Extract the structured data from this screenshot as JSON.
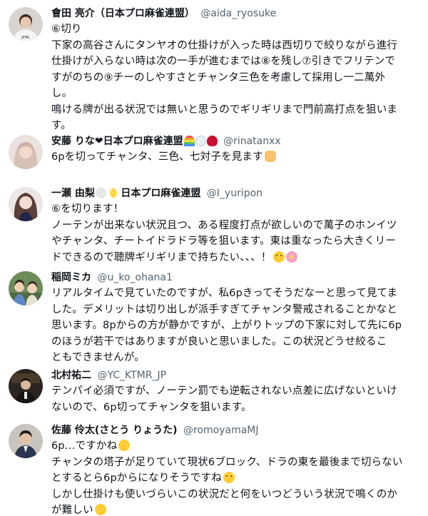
{
  "tweets": [
    {
      "name": "會田 亮介（日本プロ麻雀連盟）",
      "handle": "@aida_ryosuke",
      "lines": [
        "⑥切り",
        "下家の高谷さんにタンヤオの仕掛けが入った時は西切りで絞りながら進行",
        "仕掛けが入らない時は次の一手が進むまでは⑧を残し⑦引きでフリテンで",
        "すがのちの⑨チーのしやすさとチャンタ三色を考慮して採用し一二萬外",
        "し。",
        "鳴ける牌が出る状況では無いと思うのでギリギリまで門前高打点を狙いま",
        "す。"
      ]
    },
    {
      "name": "安藤 りな❤日本プロ麻雀連盟",
      "name_emojis": [
        "rainbow",
        "snowman",
        "rose"
      ],
      "handle": "@rinatanxx",
      "lines": [
        "6pを切ってチャンタ、三色、七対子を見ます"
      ],
      "end_emoji": "person-raising-hand"
    },
    {
      "name": "一瀬 由梨",
      "name_emojis": [
        "rabbit",
        "moon"
      ],
      "name_suffix": "日本プロ麻雀連盟",
      "handle": "@I_yuripon",
      "lines": [
        "⑥を切ります！",
        "ノーテンが出来ない状況且つ、ある程度打点が欲しいので萬子のホンイツ",
        "やチャンタ、チートイドラドラ等を狙います。東は重なったら大きくリー",
        "ドできるので聴牌ギリギリまで持ちたい、、、！"
      ],
      "end_emoji": "smiling-face-flower"
    },
    {
      "name": "稲岡ミカ",
      "handle": "@u_ko_ohana1",
      "lines": [
        "リアルタイムで見ていたのですが、私6pきってそうだなーと思って見てま",
        "した。デメリットは切り出しが派手すぎてチャンタ警戒されることかなと",
        "思います。8pからの方が静かですが、上がりトップの下家に対して先に6p",
        "のほうが若干ではありますが良いと思いました。この状況どうせ絞るこ",
        "ともできませんが。"
      ]
    },
    {
      "name": "北村祐二",
      "handle": "@YC_KTMR_JP",
      "lines": [
        "テンパイ必須ですが、ノーテン罰でも逆転されない点差に広げないといけ",
        "ないので、6p切ってチャンタを狙います。"
      ]
    },
    {
      "name": "佐藤 伶太(さとう りょうた)",
      "handle": "@romoyamaMJ",
      "lines": [
        "6p…ですかね",
        "チャンタの塔子が足りていて現状6ブロック、ドラの東を最後まで切らない",
        "とするとら6pからになりそうですね",
        "しかし仕掛けも使いづらいこの状況だと何をいつどういう状況で鳴くのか",
        "が難しい"
      ]
    }
  ]
}
